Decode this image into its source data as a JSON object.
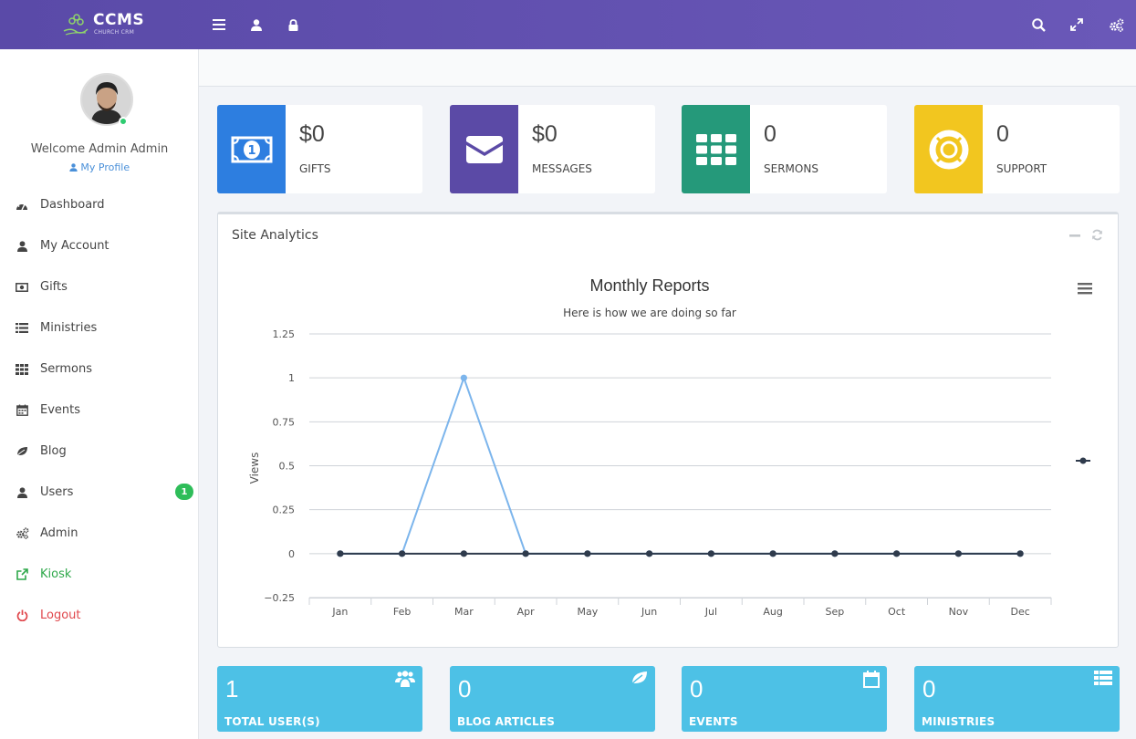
{
  "brand": {
    "name": "CCMS",
    "tagline": "CHURCH CRM"
  },
  "sidebar": {
    "welcome": "Welcome Admin Admin",
    "profile_link": "My Profile",
    "items": [
      {
        "label": "Dashboard",
        "icon": "dashboard-icon"
      },
      {
        "label": "My Account",
        "icon": "user-icon"
      },
      {
        "label": "Gifts",
        "icon": "money-icon"
      },
      {
        "label": "Ministries",
        "icon": "list-icon"
      },
      {
        "label": "Sermons",
        "icon": "grid-icon"
      },
      {
        "label": "Events",
        "icon": "calendar-icon"
      },
      {
        "label": "Blog",
        "icon": "leaf-icon"
      },
      {
        "label": "Users",
        "icon": "user-icon",
        "badge": "1"
      },
      {
        "label": "Admin",
        "icon": "cogs-icon"
      },
      {
        "label": "Kiosk",
        "icon": "external-link-icon"
      },
      {
        "label": "Logout",
        "icon": "power-icon"
      }
    ]
  },
  "stats": [
    {
      "value": "$0",
      "label": "GIFTS",
      "color": "#2d7ee0",
      "icon": "money-icon"
    },
    {
      "value": "$0",
      "label": "MESSAGES",
      "color": "#5b4aa6",
      "icon": "envelope-icon"
    },
    {
      "value": "0",
      "label": "SERMONS",
      "color": "#25997a",
      "icon": "grid-icon"
    },
    {
      "value": "0",
      "label": "SUPPORT",
      "color": "#f2c61f",
      "icon": "lifebuoy-icon"
    }
  ],
  "panel": {
    "title": "Site Analytics"
  },
  "chart_data": {
    "type": "line",
    "title": "Monthly Reports",
    "subtitle": "Here is how we are doing so far",
    "ylabel": "Views",
    "categories": [
      "Jan",
      "Feb",
      "Mar",
      "Apr",
      "May",
      "Jun",
      "Jul",
      "Aug",
      "Sep",
      "Oct",
      "Nov",
      "Dec"
    ],
    "yticks": [
      "1.25",
      "1",
      "0.75",
      "0.5",
      "0.25",
      "0",
      "−0.25"
    ],
    "ylim": [
      -0.25,
      1.25
    ],
    "grid": true,
    "series": [
      {
        "values": [
          0,
          0,
          1,
          0,
          0,
          0,
          0,
          0,
          0,
          0,
          0,
          0
        ],
        "color": "#7cb5ec"
      },
      {
        "values": [
          0,
          0,
          0,
          0,
          0,
          0,
          0,
          0,
          0,
          0,
          0,
          0
        ],
        "color": "#2f3b4c"
      }
    ]
  },
  "tiles": [
    {
      "value": "1",
      "label": "TOTAL USER(S)",
      "icon": "users-icon"
    },
    {
      "value": "0",
      "label": "BLOG ARTICLES",
      "icon": "leaf-icon"
    },
    {
      "value": "0",
      "label": "EVENTS",
      "icon": "calendar-icon"
    },
    {
      "value": "0",
      "label": "MINISTRIES",
      "icon": "list-icon"
    }
  ]
}
